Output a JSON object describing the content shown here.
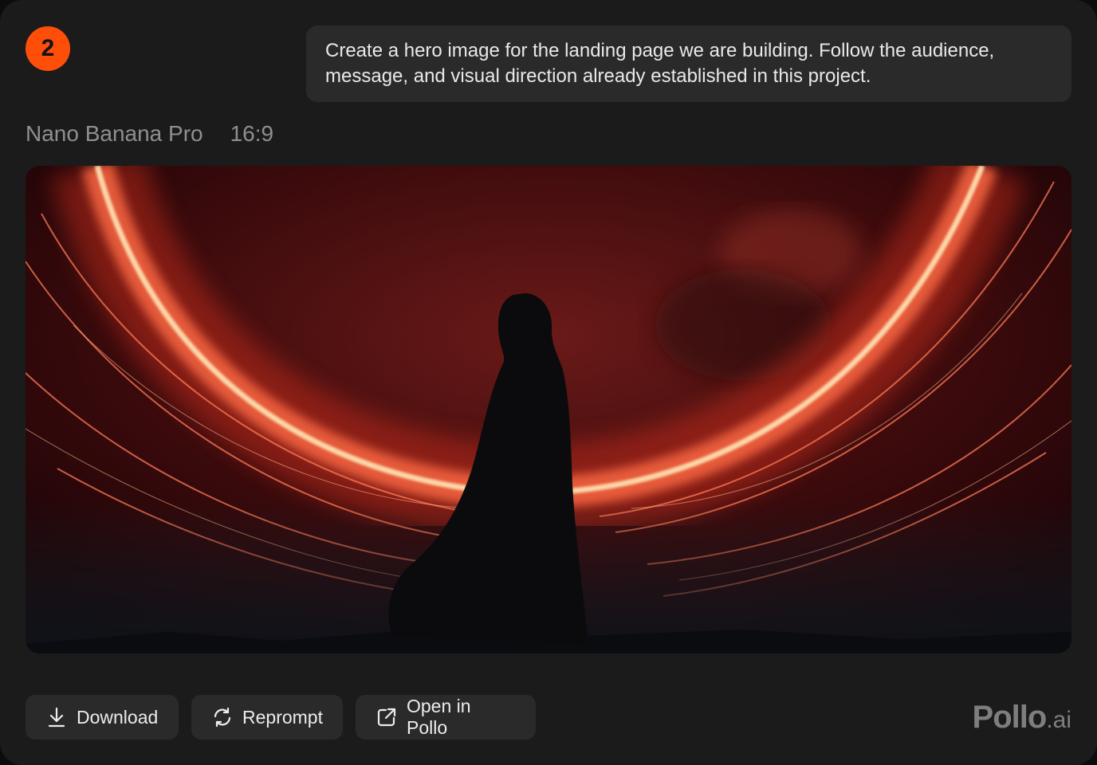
{
  "step": {
    "number": "2",
    "color": "#ff4d0a"
  },
  "prompt": {
    "text": "Create a hero image for the landing page we are building. Follow the audience, message, and visual direction already established in this project."
  },
  "meta": {
    "model": "Nano Banana Pro",
    "aspect_ratio": "16:9"
  },
  "image": {
    "description_icon": "generated-image",
    "palette": {
      "sky": "#3a0a0c",
      "glow": "#ff6a45",
      "core": "#ffe0b0",
      "shadow": "#0d1014"
    }
  },
  "actions": {
    "download": {
      "label": "Download",
      "icon": "download-icon"
    },
    "reprompt": {
      "label": "Reprompt",
      "icon": "refresh-icon"
    },
    "open": {
      "label": "Open in Pollo",
      "icon": "external-link-icon"
    }
  },
  "brand": {
    "name": "Pollo",
    "tld": ".ai"
  }
}
